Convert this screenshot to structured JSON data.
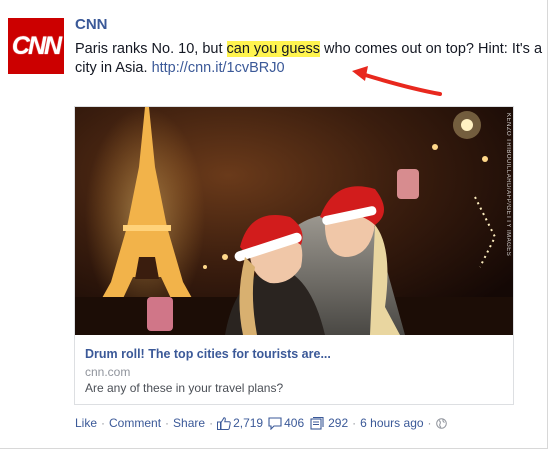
{
  "post": {
    "author": "CNN",
    "logo_text": "CNN",
    "text_before": "Paris ranks No. 10, but ",
    "text_highlight": "can you guess",
    "text_after": " who comes out on top? Hint: It's a city in Asia. ",
    "link": "http://cnn.it/1cvBRJ0"
  },
  "attachment": {
    "watermark": "KENZO TRIBOUILLARD/AFP/GETTY IMAGES",
    "title": "Drum roll! The top cities for tourists are...",
    "domain": "cnn.com",
    "description": "Are any of these in your travel plans?"
  },
  "actions": {
    "like": "Like",
    "comment": "Comment",
    "share": "Share",
    "likes_count": "2,719",
    "comments_count": "406",
    "shares_count": "292",
    "time": "6 hours ago"
  },
  "colors": {
    "link": "#3b5998",
    "brand": "#cc0000",
    "highlight": "#fff44f",
    "arrow": "#e8281e"
  }
}
